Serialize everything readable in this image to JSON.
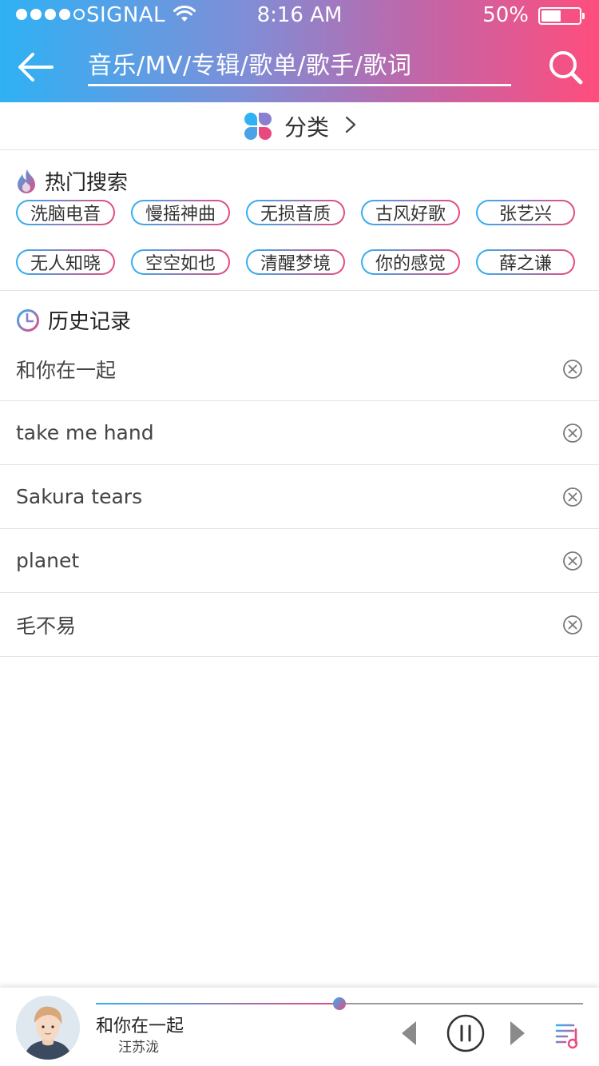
{
  "status_bar": {
    "carrier": "SIGNAL",
    "time": "8:16 AM",
    "battery": "50%"
  },
  "search": {
    "placeholder": "音乐/MV/专辑/歌单/歌手/歌词",
    "value": ""
  },
  "category": {
    "label": "分类"
  },
  "hot_search": {
    "title": "热门搜索",
    "tags": [
      [
        "洗脑电音",
        "慢摇神曲",
        "无损音质",
        "古风好歌",
        "张艺兴"
      ],
      [
        "无人知晓",
        "空空如也",
        "清醒梦境",
        "你的感觉",
        "薛之谦"
      ]
    ]
  },
  "history": {
    "title": "历史记录",
    "items": [
      "和你在一起",
      "take me hand",
      "Sakura tears",
      "planet",
      "毛不易"
    ]
  },
  "player": {
    "song_title": "和你在一起",
    "artist": "汪苏泷",
    "progress": 0.5
  },
  "colors": {
    "gradient_start": "#2fb1f4",
    "gradient_end": "#ff4d7d"
  },
  "icons": {
    "back": "arrow-left-icon",
    "search": "magnifier-icon",
    "category": "four-petal-icon",
    "hot": "flame-icon",
    "history": "clock-icon",
    "remove": "circle-x-icon",
    "prev": "triangle-left-icon",
    "pause": "circle-pause-icon",
    "next": "triangle-right-icon",
    "playlist": "playlist-music-icon"
  }
}
